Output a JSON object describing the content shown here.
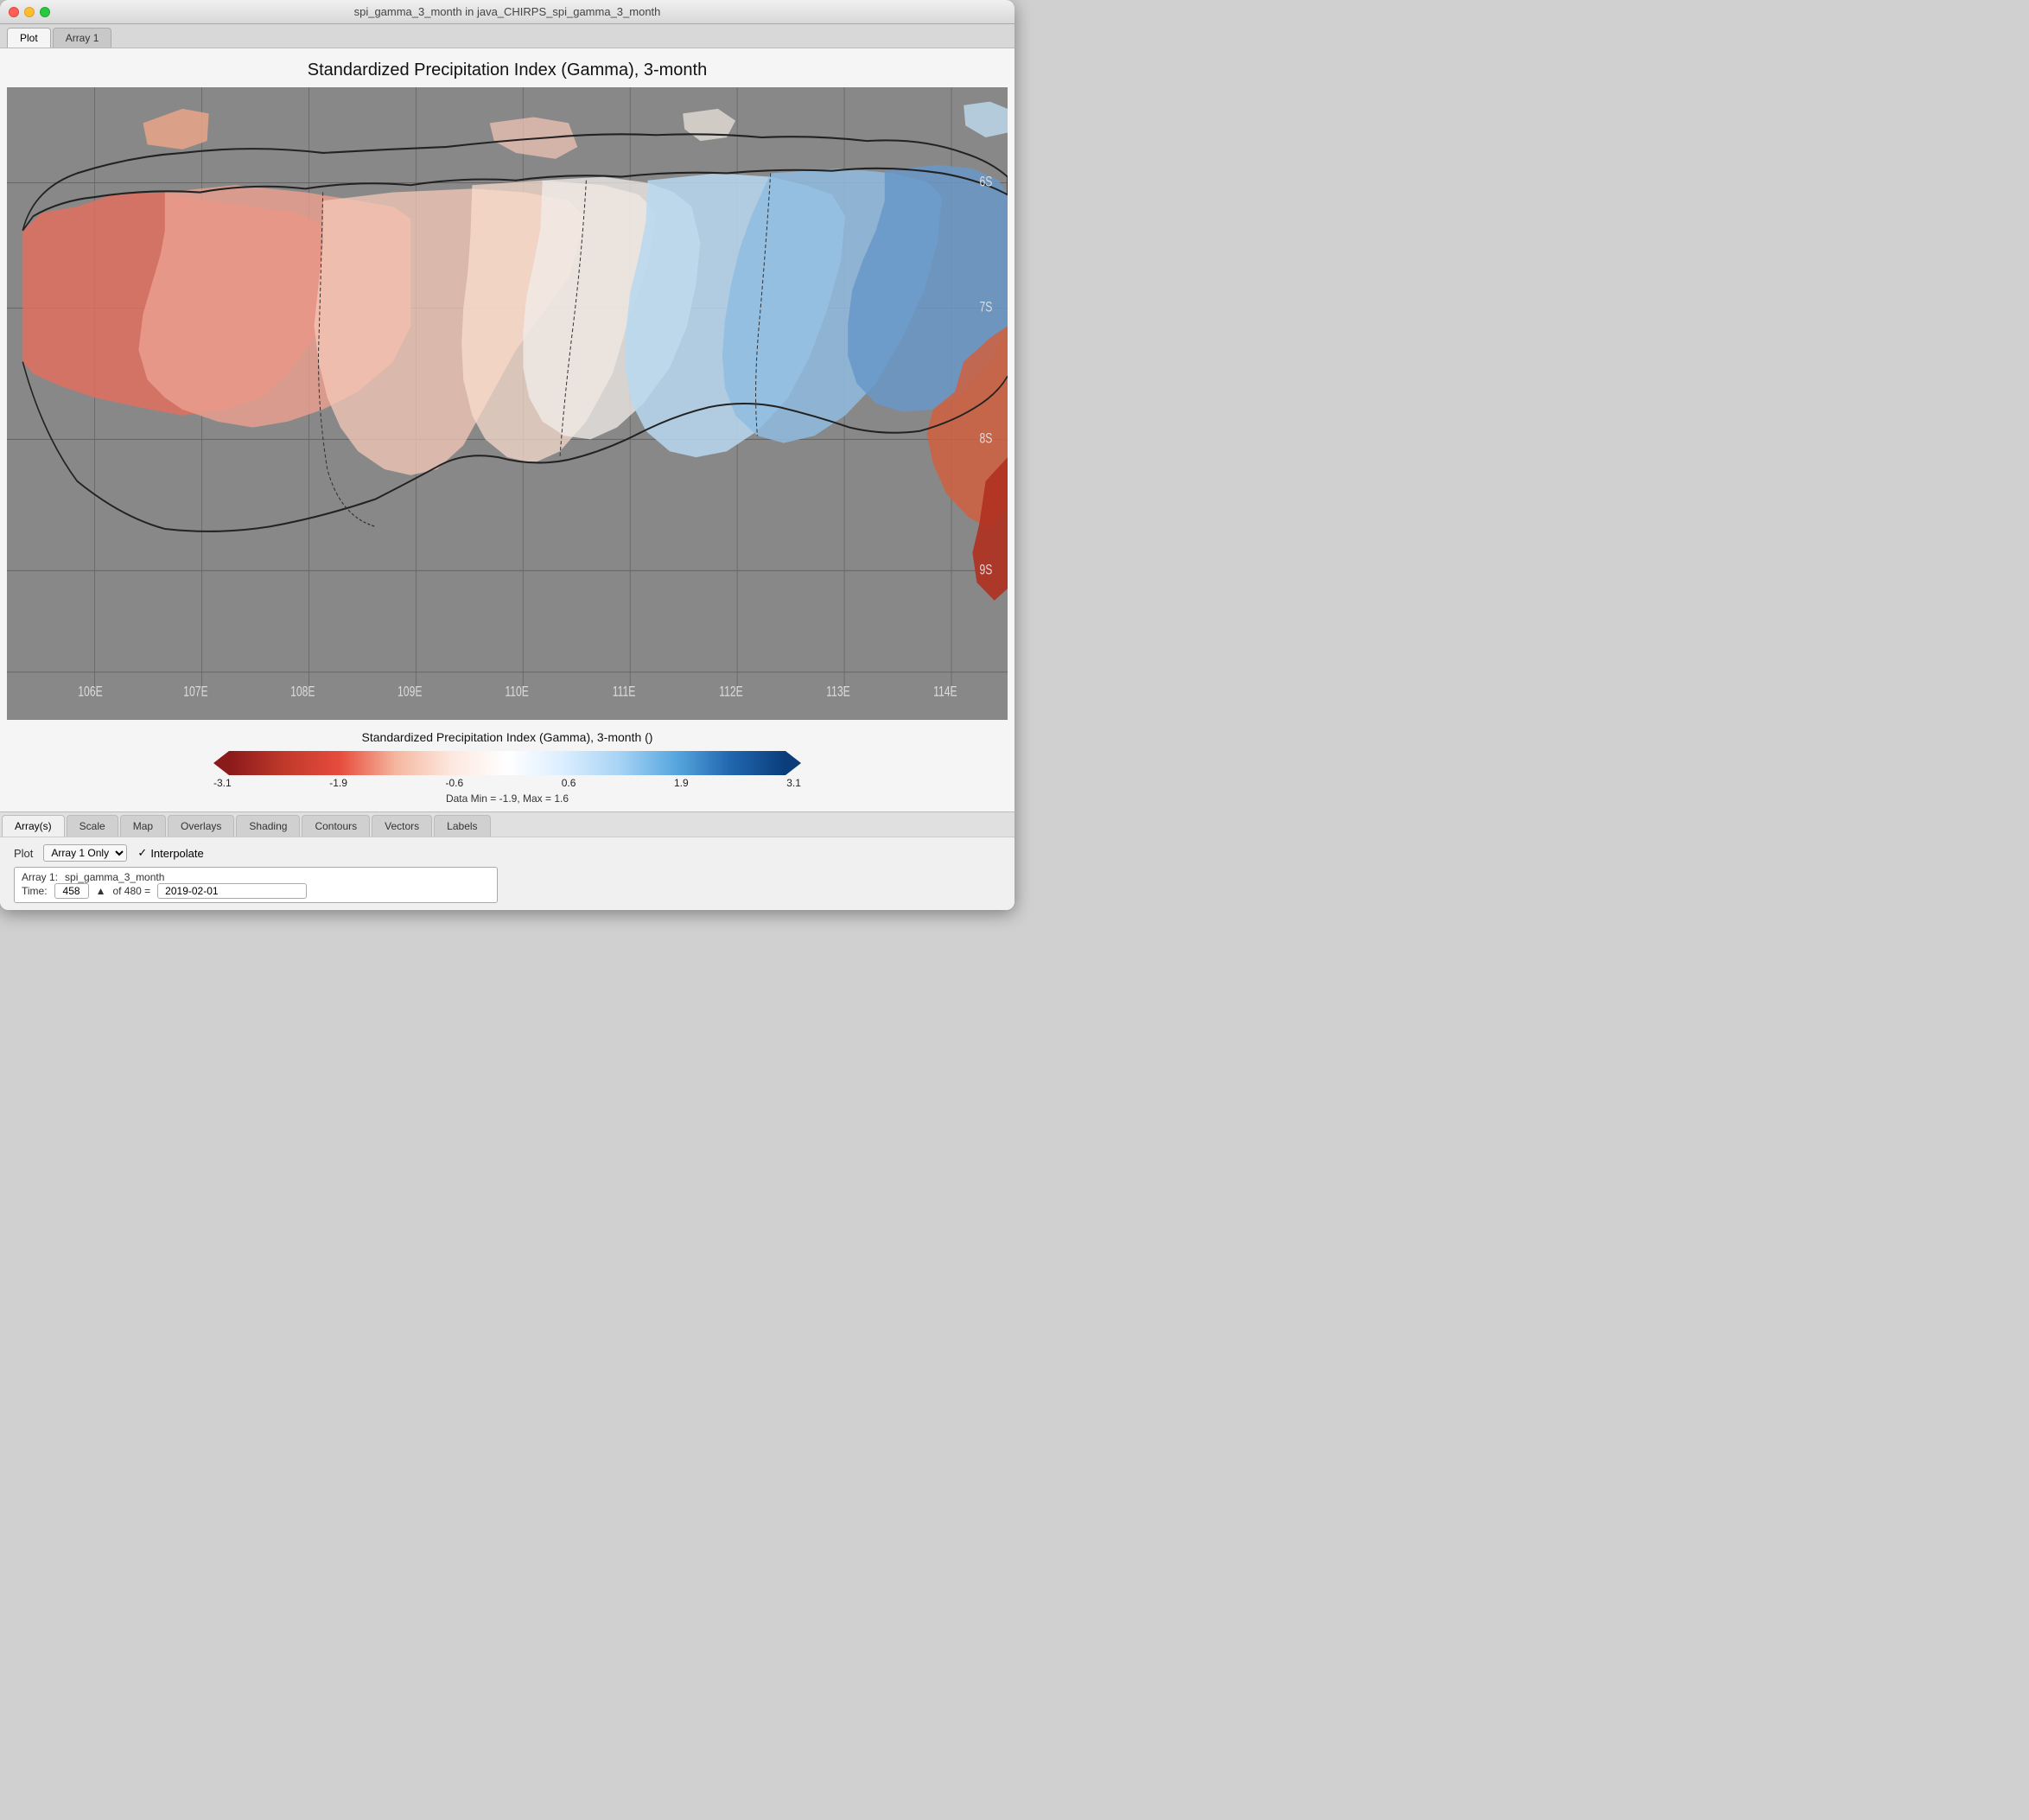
{
  "window": {
    "title": "spi_gamma_3_month in java_CHIRPS_spi_gamma_3_month"
  },
  "tabs": [
    {
      "label": "Plot",
      "active": true
    },
    {
      "label": "Array 1",
      "active": false
    }
  ],
  "chart": {
    "title": "Standardized Precipitation Index (Gamma), 3-month",
    "y_labels": [
      "6S",
      "7S",
      "8S",
      "9S"
    ],
    "x_labels": [
      "106E",
      "107E",
      "108E",
      "109E",
      "110E",
      "111E",
      "112E",
      "113E",
      "114E"
    ]
  },
  "legend": {
    "title": "Standardized Precipitation Index (Gamma), 3-month ()",
    "ticks": [
      "-3.1",
      "-1.9",
      "-0.6",
      "0.6",
      "1.9",
      "3.1"
    ],
    "data_info": "Data Min = -1.9, Max = 1.6"
  },
  "bottom_tabs": [
    {
      "label": "Array(s)",
      "active": true
    },
    {
      "label": "Scale"
    },
    {
      "label": "Map"
    },
    {
      "label": "Overlays"
    },
    {
      "label": "Shading"
    },
    {
      "label": "Contours"
    },
    {
      "label": "Vectors"
    },
    {
      "label": "Labels"
    }
  ],
  "controls": {
    "plot_label": "Plot",
    "plot_select": "Array 1 Only",
    "interpolate_label": "Interpolate",
    "array_label": "Array 1:",
    "array_value": "spi_gamma_3_month",
    "time_label": "Time:",
    "time_value": "458",
    "time_of": "of 480 =",
    "time_date": "2019-02-01"
  }
}
